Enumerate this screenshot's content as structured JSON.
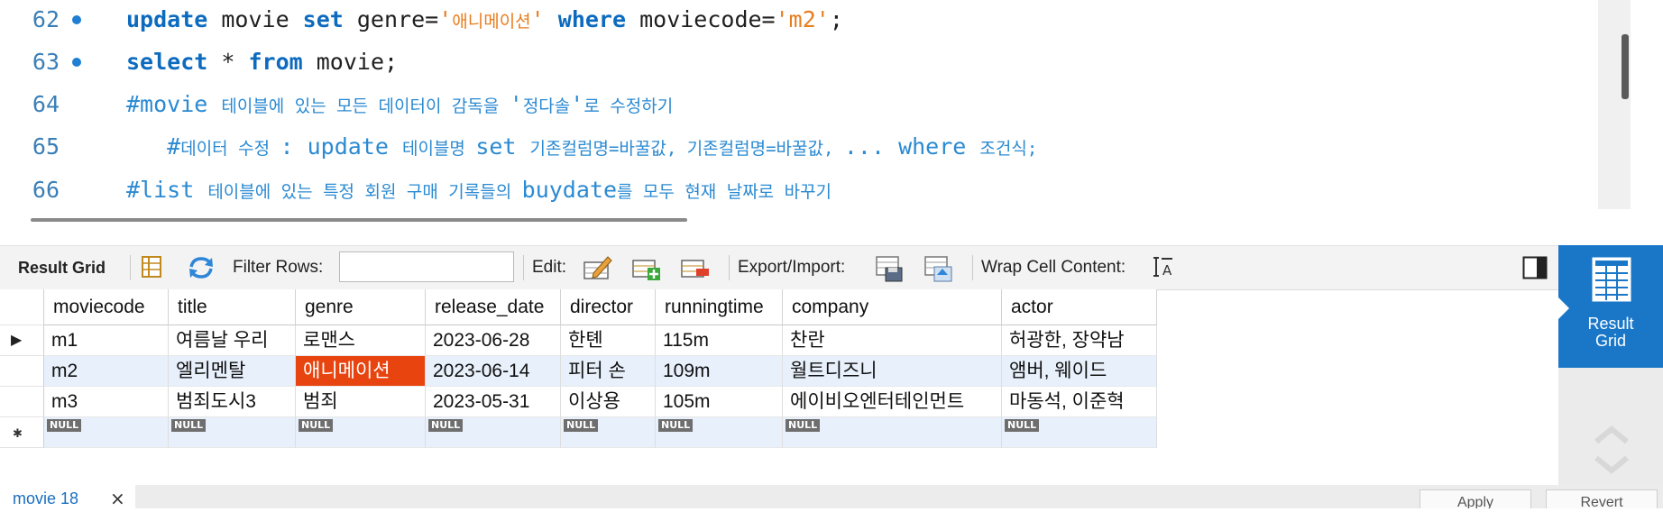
{
  "editor": {
    "lines": [
      {
        "num": "62",
        "breakpoint": true,
        "parts": [
          {
            "t": "update",
            "c": "kw"
          },
          {
            "t": " movie ",
            "c": ""
          },
          {
            "t": "set",
            "c": "kw"
          },
          {
            "t": " genre=",
            "c": ""
          },
          {
            "t": "'",
            "c": "str"
          },
          {
            "t": "애니메이션",
            "c": "str cm-small"
          },
          {
            "t": "'",
            "c": "str"
          },
          {
            "t": " ",
            "c": ""
          },
          {
            "t": "where",
            "c": "kw"
          },
          {
            "t": " moviecode=",
            "c": ""
          },
          {
            "t": "'m2'",
            "c": "str"
          },
          {
            "t": ";",
            "c": ""
          }
        ]
      },
      {
        "num": "63",
        "breakpoint": true,
        "parts": [
          {
            "t": "select",
            "c": "kw"
          },
          {
            "t": " * ",
            "c": ""
          },
          {
            "t": "from",
            "c": "kw"
          },
          {
            "t": " movie;",
            "c": ""
          }
        ]
      },
      {
        "num": "64",
        "breakpoint": false,
        "parts": [
          {
            "t": "#movie ",
            "c": "cm"
          },
          {
            "t": "테이블에 있는 모든 데이터이 감독을 ",
            "c": "cm cm-small"
          },
          {
            "t": "'",
            "c": "cm"
          },
          {
            "t": "정다솔",
            "c": "cm cm-small"
          },
          {
            "t": "'",
            "c": "cm"
          },
          {
            "t": "로 수정하기",
            "c": "cm cm-small"
          }
        ]
      },
      {
        "num": "65",
        "breakpoint": false,
        "parts": [
          {
            "t": "   #",
            "c": "cm"
          },
          {
            "t": "데이터 수정 ",
            "c": "cm cm-small"
          },
          {
            "t": ": update ",
            "c": "cm"
          },
          {
            "t": "테이블명 ",
            "c": "cm cm-small"
          },
          {
            "t": "set ",
            "c": "cm"
          },
          {
            "t": "기존컬럼명=바꿀값, 기존컬럼명=바꿀값, ",
            "c": "cm cm-small"
          },
          {
            "t": "... where ",
            "c": "cm"
          },
          {
            "t": "조건식;",
            "c": "cm cm-small"
          }
        ]
      },
      {
        "num": "66",
        "breakpoint": false,
        "parts": [
          {
            "t": "#list ",
            "c": "cm"
          },
          {
            "t": "테이블에 있는 특정 회원 구매 기록들의 ",
            "c": "cm cm-small"
          },
          {
            "t": "buydate",
            "c": "cm"
          },
          {
            "t": "를 모두 현재 날짜로 바꾸기",
            "c": "cm cm-small"
          }
        ]
      }
    ]
  },
  "toolbar": {
    "result_grid_label": "Result Grid",
    "filter_rows_label": "Filter Rows:",
    "filter_rows_value": "",
    "edit_label": "Edit:",
    "export_import_label": "Export/Import:",
    "wrap_cell_label": "Wrap Cell Content:"
  },
  "grid": {
    "columns": [
      "moviecode",
      "title",
      "genre",
      "release_date",
      "director",
      "runningtime",
      "company",
      "actor"
    ],
    "rows": [
      [
        "m1",
        "여름날 우리",
        "로맨스",
        "2023-06-28",
        "한톈",
        "115m",
        "찬란",
        "허광한, 장약남"
      ],
      [
        "m2",
        "엘리멘탈",
        "애니메이션",
        "2023-06-14",
        "피터 손",
        "109m",
        "월트디즈니",
        "앰버, 웨이드"
      ],
      [
        "m3",
        "범죄도시3",
        "범죄",
        "2023-05-31",
        "이상용",
        "105m",
        "에이비오엔터테인먼트",
        "마동석, 이준혁"
      ]
    ],
    "null_label": "NULL",
    "selected_cell": {
      "row": 1,
      "col": 2
    },
    "current_row_marker": "▶",
    "new_row_marker": "✱"
  },
  "side_panel": {
    "result_grid_line1": "Result",
    "result_grid_line2": "Grid"
  },
  "bottom": {
    "tab_label": "movie 18",
    "close_glyph": "×",
    "apply_label": "Apply",
    "revert_label": "Revert"
  },
  "colors": {
    "keyword": "#0d6bbf",
    "string": "#e87d1e",
    "comment": "#2b8ad2",
    "selected_cell": "#e8440f",
    "side_panel": "#1a77c8"
  }
}
